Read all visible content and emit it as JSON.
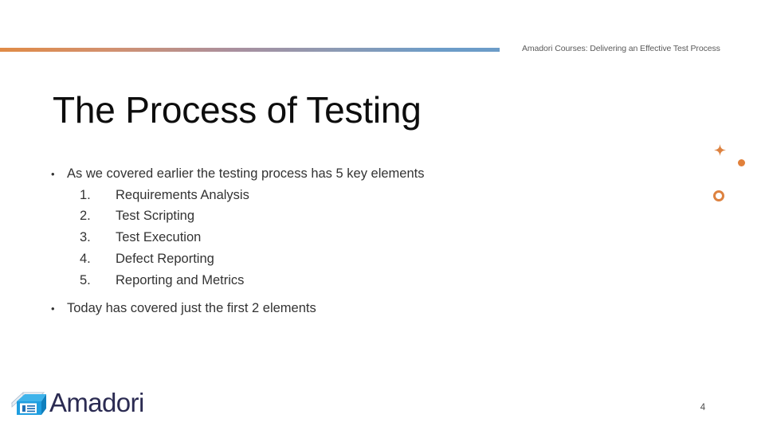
{
  "header": {
    "course_label": "Amadori Courses: Delivering an Effective Test Process"
  },
  "title": "The Process of Testing",
  "body": {
    "bullet_marker": "•",
    "bullet_1": "As we covered earlier the testing process has 5 key elements",
    "numbered_items": [
      {
        "marker": "1.",
        "label": "Requirements Analysis"
      },
      {
        "marker": "2.",
        "label": "Test Scripting"
      },
      {
        "marker": "3.",
        "label": "Test Execution"
      },
      {
        "marker": "4.",
        "label": "Defect Reporting"
      },
      {
        "marker": "5.",
        "label": "Reporting and Metrics"
      }
    ],
    "bullet_2": "Today has covered just the first 2 elements"
  },
  "decorations": {
    "sparkle": "four-point-star-icon",
    "dot": "filled-circle-icon",
    "ring": "ring-circle-icon",
    "accent_color": "#e1803a"
  },
  "footer": {
    "logo_text": "Amadori",
    "logo_icon": "book-logo-icon",
    "page_number": "4"
  },
  "theme": {
    "rule_start_color": "#e08b46",
    "rule_mid_color": "#a98f9e",
    "rule_end_color": "#6c9cc8",
    "title_color": "#0d0d0d",
    "body_color": "#333333",
    "logo_color": "#2b2b52"
  }
}
